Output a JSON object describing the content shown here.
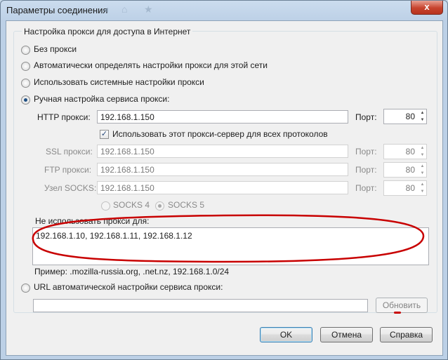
{
  "window": {
    "title": "Параметры соединения",
    "close_label": "x"
  },
  "group": {
    "legend": "Настройка прокси для доступа в Интернет"
  },
  "options": {
    "no_proxy": "Без прокси",
    "auto_detect": "Автоматически определять настройки прокси для этой сети",
    "system": "Использовать системные настройки прокси",
    "manual": "Ручная настройка сервиса прокси:",
    "selected": "manual"
  },
  "manual": {
    "http_label": "HTTP прокси:",
    "http_value": "192.168.1.150",
    "port_label": "Порт:",
    "http_port": "80",
    "use_for_all_label": "Использовать этот прокси-сервер для всех протоколов",
    "use_for_all_checked": "✓",
    "ssl_label": "SSL прокси:",
    "ssl_value": "192.168.1.150",
    "ssl_port": "80",
    "ftp_label": "FTP прокси:",
    "ftp_value": "192.168.1.150",
    "ftp_port": "80",
    "socks_label": "Узел SOCKS:",
    "socks_value": "192.168.1.150",
    "socks_port": "80",
    "socks4": "SOCKS 4",
    "socks5": "SOCKS 5"
  },
  "no_proxy_for": {
    "label": "Не использовать прокси для:",
    "value": "192.168.1.10, 192.168.1.11, 192.168.1.12",
    "example": "Пример: .mozilla-russia.org, .net.nz, 192.168.1.0/24"
  },
  "auto_config": {
    "label": "URL автоматической настройки сервиса прокси:",
    "value": "",
    "reload_label": "Обновить"
  },
  "buttons": {
    "ok": "OK",
    "cancel": "Отмена",
    "help": "Справка"
  },
  "colors": {
    "annotation": "#c80000",
    "title_bar": "#bcd0e6",
    "close_button": "#c7432d"
  },
  "icons": [
    "close-icon",
    "radio-icon",
    "checkbox-icon",
    "spinner-icon"
  ]
}
